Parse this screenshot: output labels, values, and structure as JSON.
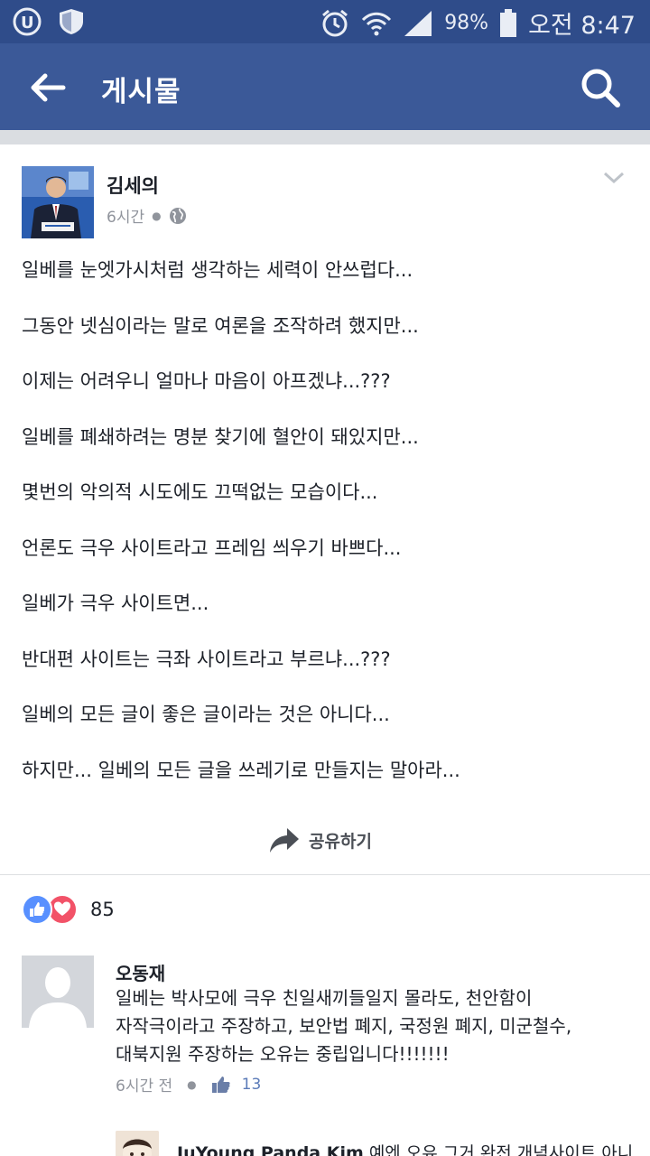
{
  "status_bar": {
    "battery": "98%",
    "time": "오전 8:47",
    "icons": [
      "u-app-icon",
      "shield-icon",
      "alarm-icon",
      "wifi-icon",
      "signal-icon",
      "battery-icon"
    ]
  },
  "app_bar": {
    "title": "게시물",
    "back_icon": "arrow-left-icon",
    "search_icon": "search-icon"
  },
  "post": {
    "author": "김세의",
    "time": "6시간",
    "privacy_icon": "globe-icon",
    "lines": [
      "일베를 눈엣가시처럼 생각하는 세력이 안쓰럽다...",
      "그동안 넷심이라는 말로 여론을 조작하려 했지만...",
      "이제는 어려우니 얼마나 마음이 아프겠냐...???",
      "일베를 폐쇄하려는 명분 찾기에 혈안이 돼있지만...",
      "몇번의 악의적 시도에도 끄떡없는 모습이다...",
      "언론도 극우 사이트라고 프레임 씌우기 바쁘다...",
      "일베가 극우 사이트면...",
      "반대편 사이트는 극좌 사이트라고 부르냐...???",
      "일베의 모든 글이 좋은 글이라는 것은 아니다...",
      "하지만... 일베의 모든 글을 쓰레기로 만들지는 말아라..."
    ],
    "share_label": "공유하기",
    "reaction_count": "85"
  },
  "comment": {
    "author": "오동재",
    "lines": [
      "일베는 박사모에 극우 친일새끼들일지 몰라도, 천안함이",
      "자작극이라고 주장하고, 보안법 폐지, 국정원 폐지, 미군철수,",
      "대북지원 주장하는 오유는 중립입니다!!!!!!!"
    ],
    "time": "6시간 전",
    "like_count": "13"
  },
  "reply": {
    "author": "JuYoung Panda Kim",
    "text": "예엔 오유 그거 완전 개념사이트 아니"
  },
  "colors": {
    "header_bg": "#3b5998",
    "status_bg": "#2f4c8a",
    "like_blue": "#5890ff",
    "love_red": "#f25268"
  }
}
